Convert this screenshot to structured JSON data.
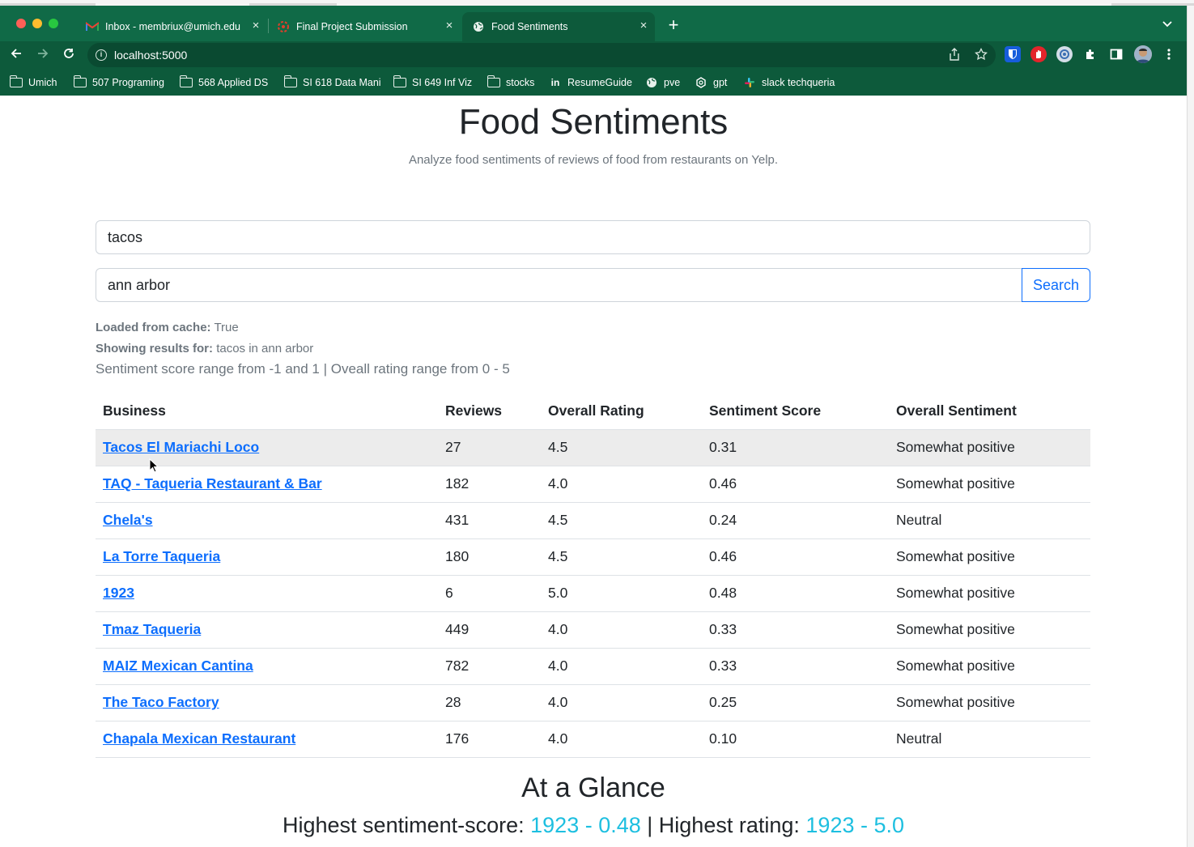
{
  "browser": {
    "tabs": [
      {
        "title": "Inbox - membriux@umich.edu",
        "icon": "gmail-icon",
        "active": false
      },
      {
        "title": "Final Project Submission",
        "icon": "canvas-icon",
        "active": false
      },
      {
        "title": "Food Sentiments",
        "icon": "globe-icon",
        "active": true
      }
    ],
    "url": "localhost:5000",
    "bookmarks": [
      {
        "label": "Umich",
        "icon": "folder-icon"
      },
      {
        "label": "507 Programing",
        "icon": "folder-icon"
      },
      {
        "label": "568 Applied DS",
        "icon": "folder-icon"
      },
      {
        "label": "SI 618 Data Mani",
        "icon": "folder-icon"
      },
      {
        "label": "SI 649 Inf Viz",
        "icon": "folder-icon"
      },
      {
        "label": "stocks",
        "icon": "folder-icon"
      },
      {
        "label": "ResumeGuide",
        "icon": "linkedin-icon"
      },
      {
        "label": "pve",
        "icon": "globe-icon"
      },
      {
        "label": "gpt",
        "icon": "openai-icon"
      },
      {
        "label": "slack techqueria",
        "icon": "slack-icon"
      }
    ]
  },
  "page": {
    "title": "Food Sentiments",
    "subtitle": "Analyze food sentiments of reviews of food from restaurants on Yelp.",
    "food_query": "tacos",
    "location_query": "ann arbor",
    "search_label": "Search",
    "cache_label": "Loaded from cache:",
    "cache_value": "True",
    "results_label": "Showing results for:",
    "results_value": "tacos in ann arbor",
    "range_note": "Sentiment score range from -1 and 1 | Oveall rating range from 0 - 5"
  },
  "table": {
    "headers": [
      "Business",
      "Reviews",
      "Overall Rating",
      "Sentiment Score",
      "Overall Sentiment"
    ],
    "rows": [
      {
        "business": "Tacos El Mariachi Loco",
        "reviews": "27",
        "rating": "4.5",
        "score": "0.31",
        "sentiment": "Somewhat positive"
      },
      {
        "business": "TAQ - Taqueria Restaurant & Bar",
        "reviews": "182",
        "rating": "4.0",
        "score": "0.46",
        "sentiment": "Somewhat positive"
      },
      {
        "business": "Chela's",
        "reviews": "431",
        "rating": "4.5",
        "score": "0.24",
        "sentiment": "Neutral"
      },
      {
        "business": "La Torre Taqueria",
        "reviews": "180",
        "rating": "4.5",
        "score": "0.46",
        "sentiment": "Somewhat positive"
      },
      {
        "business": "1923",
        "reviews": "6",
        "rating": "5.0",
        "score": "0.48",
        "sentiment": "Somewhat positive"
      },
      {
        "business": "Tmaz Taqueria",
        "reviews": "449",
        "rating": "4.0",
        "score": "0.33",
        "sentiment": "Somewhat positive"
      },
      {
        "business": "MAIZ Mexican Cantina",
        "reviews": "782",
        "rating": "4.0",
        "score": "0.33",
        "sentiment": "Somewhat positive"
      },
      {
        "business": "The Taco Factory",
        "reviews": "28",
        "rating": "4.0",
        "score": "0.25",
        "sentiment": "Somewhat positive"
      },
      {
        "business": "Chapala Mexican Restaurant",
        "reviews": "176",
        "rating": "4.0",
        "score": "0.10",
        "sentiment": "Neutral"
      }
    ]
  },
  "glance": {
    "title": "At a Glance",
    "sentiment_label": "Highest sentiment-score:",
    "sentiment_value": "1923 - 0.48",
    "separator": "|",
    "rating_label": "Highest rating:",
    "rating_value": "1923 - 5.0"
  },
  "colors": {
    "chrome": "#106a47",
    "link": "#0d6efd",
    "highlight": "#1dbfe0"
  }
}
